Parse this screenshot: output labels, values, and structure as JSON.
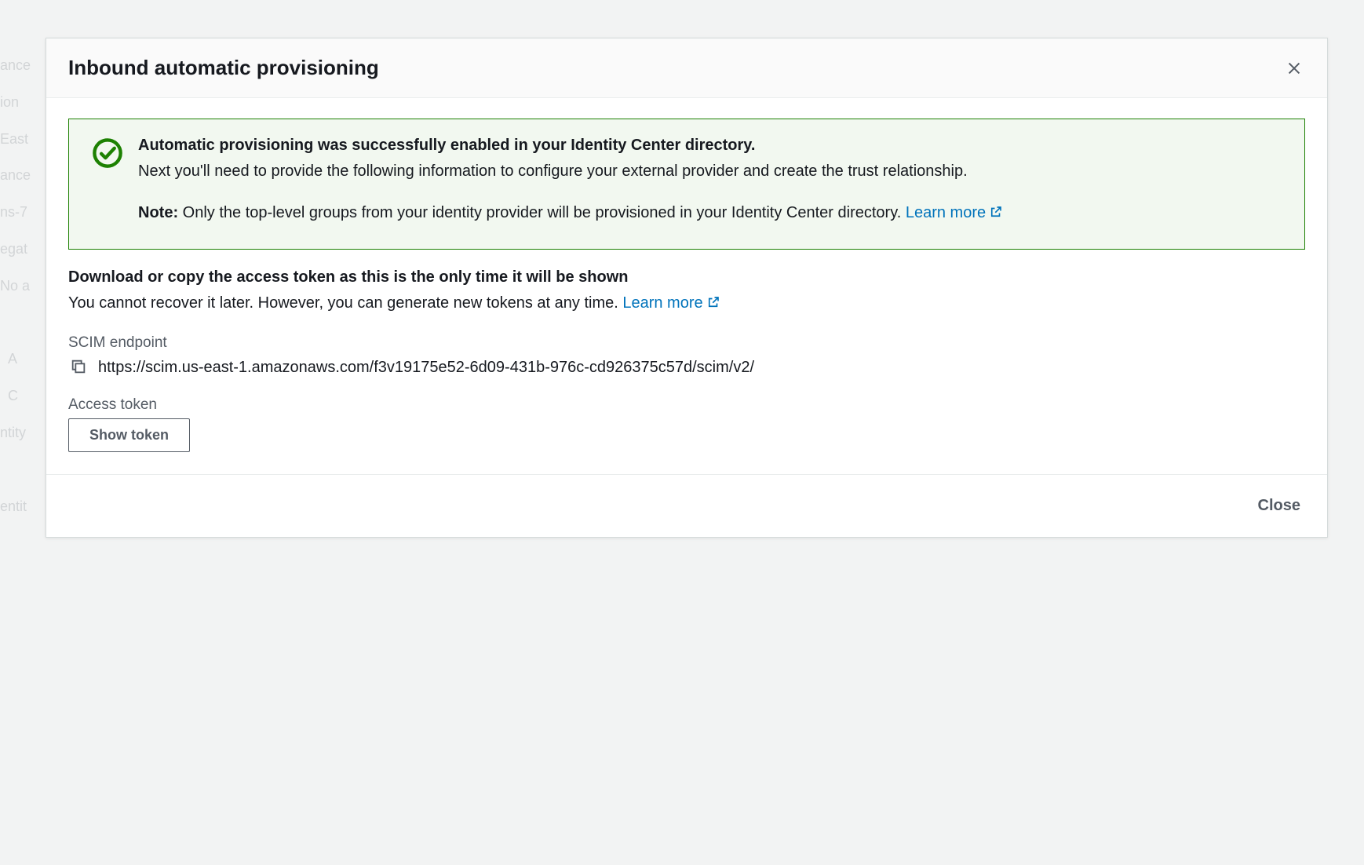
{
  "modal": {
    "title": "Inbound automatic provisioning",
    "alert": {
      "heading": "Automatic provisioning was successfully enabled in your Identity Center directory.",
      "body": "Next you'll need to provide the following information to configure your external provider and create the trust relationship.",
      "note_label": "Note:",
      "note_text": " Only the top-level groups from your identity provider will be provisioned in your Identity Center directory. ",
      "learn_more": "Learn more"
    },
    "section": {
      "title": "Download or copy the access token as this is the only time it will be shown",
      "desc_prefix": "You cannot recover it later. However, you can generate new tokens at any time. ",
      "learn_more": "Learn more"
    },
    "scim": {
      "label": "SCIM endpoint",
      "value": "https://scim.us-east-1.amazonaws.com/f3v19175e52-6d09-431b-976c-cd926375c57d/scim/v2/"
    },
    "token": {
      "label": "Access token",
      "show_button": "Show token"
    },
    "footer": {
      "close": "Close"
    }
  }
}
